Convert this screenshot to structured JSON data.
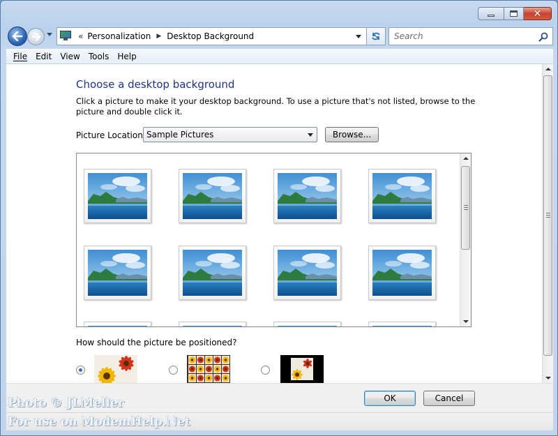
{
  "window": {
    "caption_buttons": [
      "minimize-icon",
      "maximize-icon",
      "close-icon"
    ]
  },
  "nav": {
    "back_icon": "back-arrow-icon",
    "forward_icon": "forward-arrow-icon",
    "breadcrumb_prefix": "«",
    "breadcrumb": [
      "Personalization",
      "Desktop Background"
    ],
    "search_placeholder": "Search"
  },
  "menu": {
    "items": [
      {
        "label": "File"
      },
      {
        "label": "Edit"
      },
      {
        "label": "View"
      },
      {
        "label": "Tools"
      },
      {
        "label": "Help"
      }
    ]
  },
  "content": {
    "heading": "Choose a desktop background",
    "description": "Click a picture to make it your desktop background. To use a picture that's not listed, browse to the picture and double click it.",
    "location_label": "Picture Location",
    "location_value": "Sample Pictures",
    "browse_label": "Browse...",
    "position_question": "How should the picture be positioned?",
    "position_options": [
      {
        "name": "fill",
        "selected": true
      },
      {
        "name": "tile",
        "selected": false
      },
      {
        "name": "center",
        "selected": false
      }
    ]
  },
  "gallery": {
    "thumbnail_count_visible_rows": 2,
    "thumbnails_per_row": 4
  },
  "footer": {
    "ok_label": "OK",
    "cancel_label": "Cancel"
  },
  "watermark": {
    "line1": "Photo © JLMeller",
    "line2": "For use on ModemHelp.Net"
  }
}
